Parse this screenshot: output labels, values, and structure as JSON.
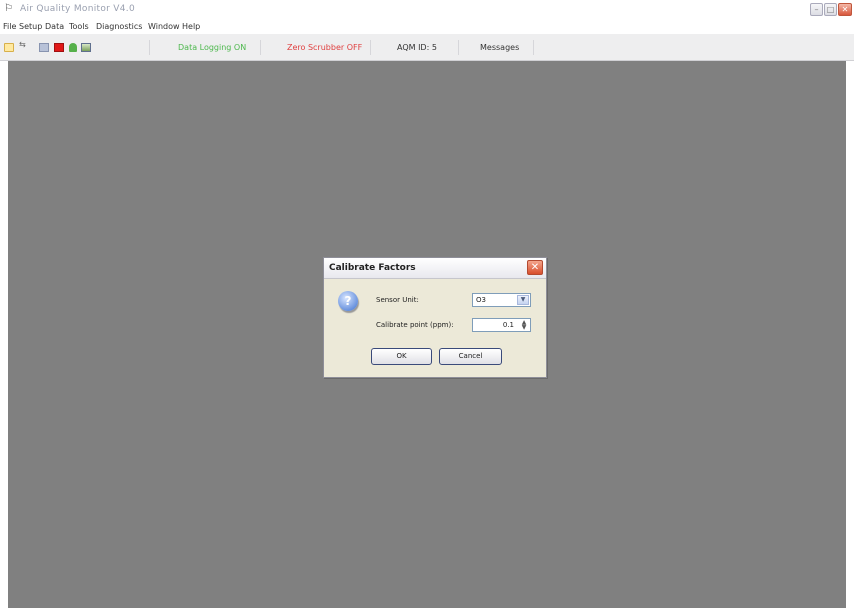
{
  "window": {
    "title": "Air Quality Monitor V4.0",
    "app_icon": "flag-icon"
  },
  "menu": [
    "File",
    "Setup",
    "Data",
    "Tools",
    "Diagnostics",
    "Window",
    "Help"
  ],
  "toolbar": {
    "icons": [
      "open-icon",
      "connect-icon",
      "grid-icon",
      "stop-icon",
      "plant-icon",
      "chart-icon"
    ],
    "data_logging": "Data Logging ON",
    "zero_scrubber": "Zero Scrubber OFF",
    "aqm_id": "AQM ID: 5",
    "messages": "Messages"
  },
  "dialog": {
    "title": "Calibrate Factors",
    "sensor_unit_label": "Sensor Unit:",
    "sensor_unit_value": "O3",
    "calibrate_point_label": "Calibrate point (ppm):",
    "calibrate_point_value": "0.1",
    "ok_label": "OK",
    "cancel_label": "Cancel"
  },
  "colors": {
    "workspace": "#808080",
    "status_on": "#4db84d",
    "status_off": "#e04040"
  }
}
